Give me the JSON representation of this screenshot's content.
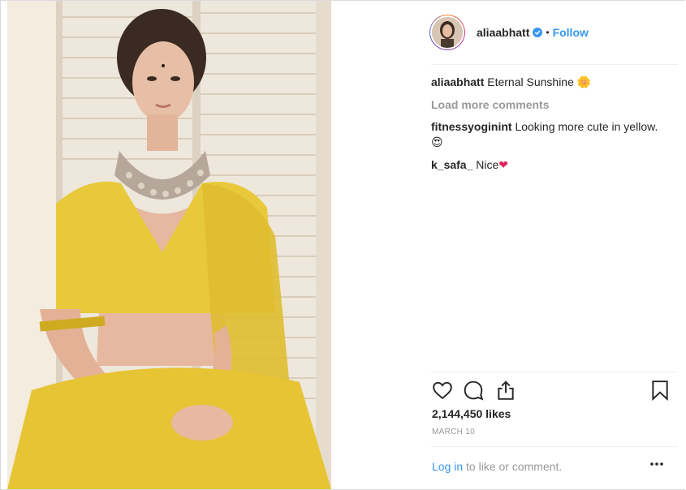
{
  "post": {
    "username": "aliaabhatt",
    "verified_icon": "verified-badge-icon",
    "separator": "•",
    "follow_label": "Follow"
  },
  "comments": [
    {
      "user": "aliaabhatt",
      "text": "Eternal Sunshine",
      "emoji": "🌼"
    },
    {
      "user": "fitnessyoginint",
      "text": "Looking more cute in yellow.",
      "emoji": "😍"
    },
    {
      "user": "k_safa_",
      "text": "Nice",
      "emoji": "❤"
    }
  ],
  "load_more_label": "Load more comments",
  "actions": {
    "like_icon": "heart-icon",
    "comment_icon": "comment-bubble-icon",
    "share_icon": "share-icon",
    "save_icon": "bookmark-icon"
  },
  "likes_text": "2,144,450 likes",
  "date_text": "MARCH 10",
  "login": {
    "link_label": "Log in",
    "rest": " to like or comment."
  },
  "more_icon": "more-options-icon",
  "colors": {
    "link_blue": "#3897f0",
    "muted": "#999999",
    "text": "#262626",
    "dress_yellow": "#e8c93a"
  }
}
